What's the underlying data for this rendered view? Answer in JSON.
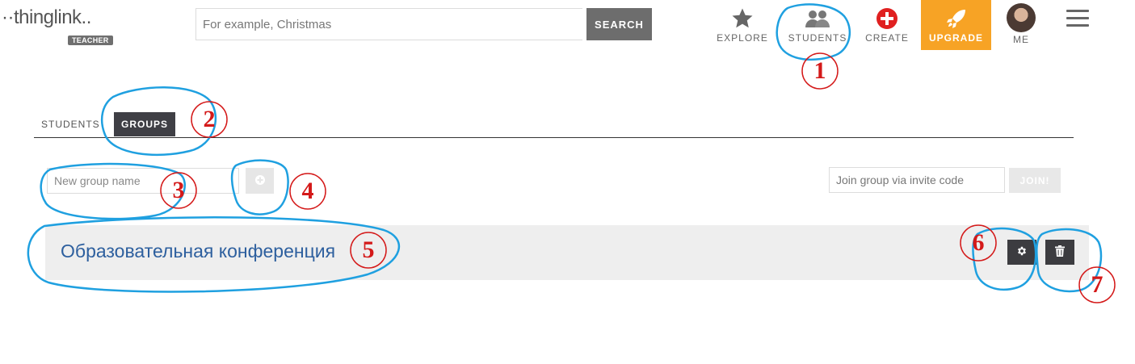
{
  "header": {
    "logo_text": "··thinglink..",
    "logo_badge": "TEACHER",
    "search": {
      "placeholder": "For example, Christmas",
      "value": "",
      "button_label": "SEARCH"
    },
    "nav": [
      {
        "label": "EXPLORE",
        "icon": "star-icon"
      },
      {
        "label": "STUDENTS",
        "icon": "people-icon"
      },
      {
        "label": "CREATE",
        "icon": "plus-circle-icon"
      },
      {
        "label": "UPGRADE",
        "icon": "rocket-icon"
      },
      {
        "label": "ME",
        "icon": "avatar"
      }
    ],
    "menu_icon": "hamburger-icon",
    "colors": {
      "upgrade_bg": "#f7a325",
      "create_icon": "#e02020"
    }
  },
  "tabs": [
    {
      "label": "STUDENTS",
      "active": false
    },
    {
      "label": "GROUPS",
      "active": true
    }
  ],
  "group_form": {
    "new_group_placeholder": "New group name",
    "new_group_value": "",
    "add_icon": "plus-circle-icon",
    "join_placeholder": "Join group via invite code",
    "join_value": "",
    "join_button_label": "JOIN!"
  },
  "groups": [
    {
      "name": "Образовательная конференция",
      "actions": [
        "gear-icon",
        "trash-icon"
      ]
    }
  ],
  "annotations": [
    "1",
    "2",
    "3",
    "4",
    "5",
    "6",
    "7"
  ]
}
